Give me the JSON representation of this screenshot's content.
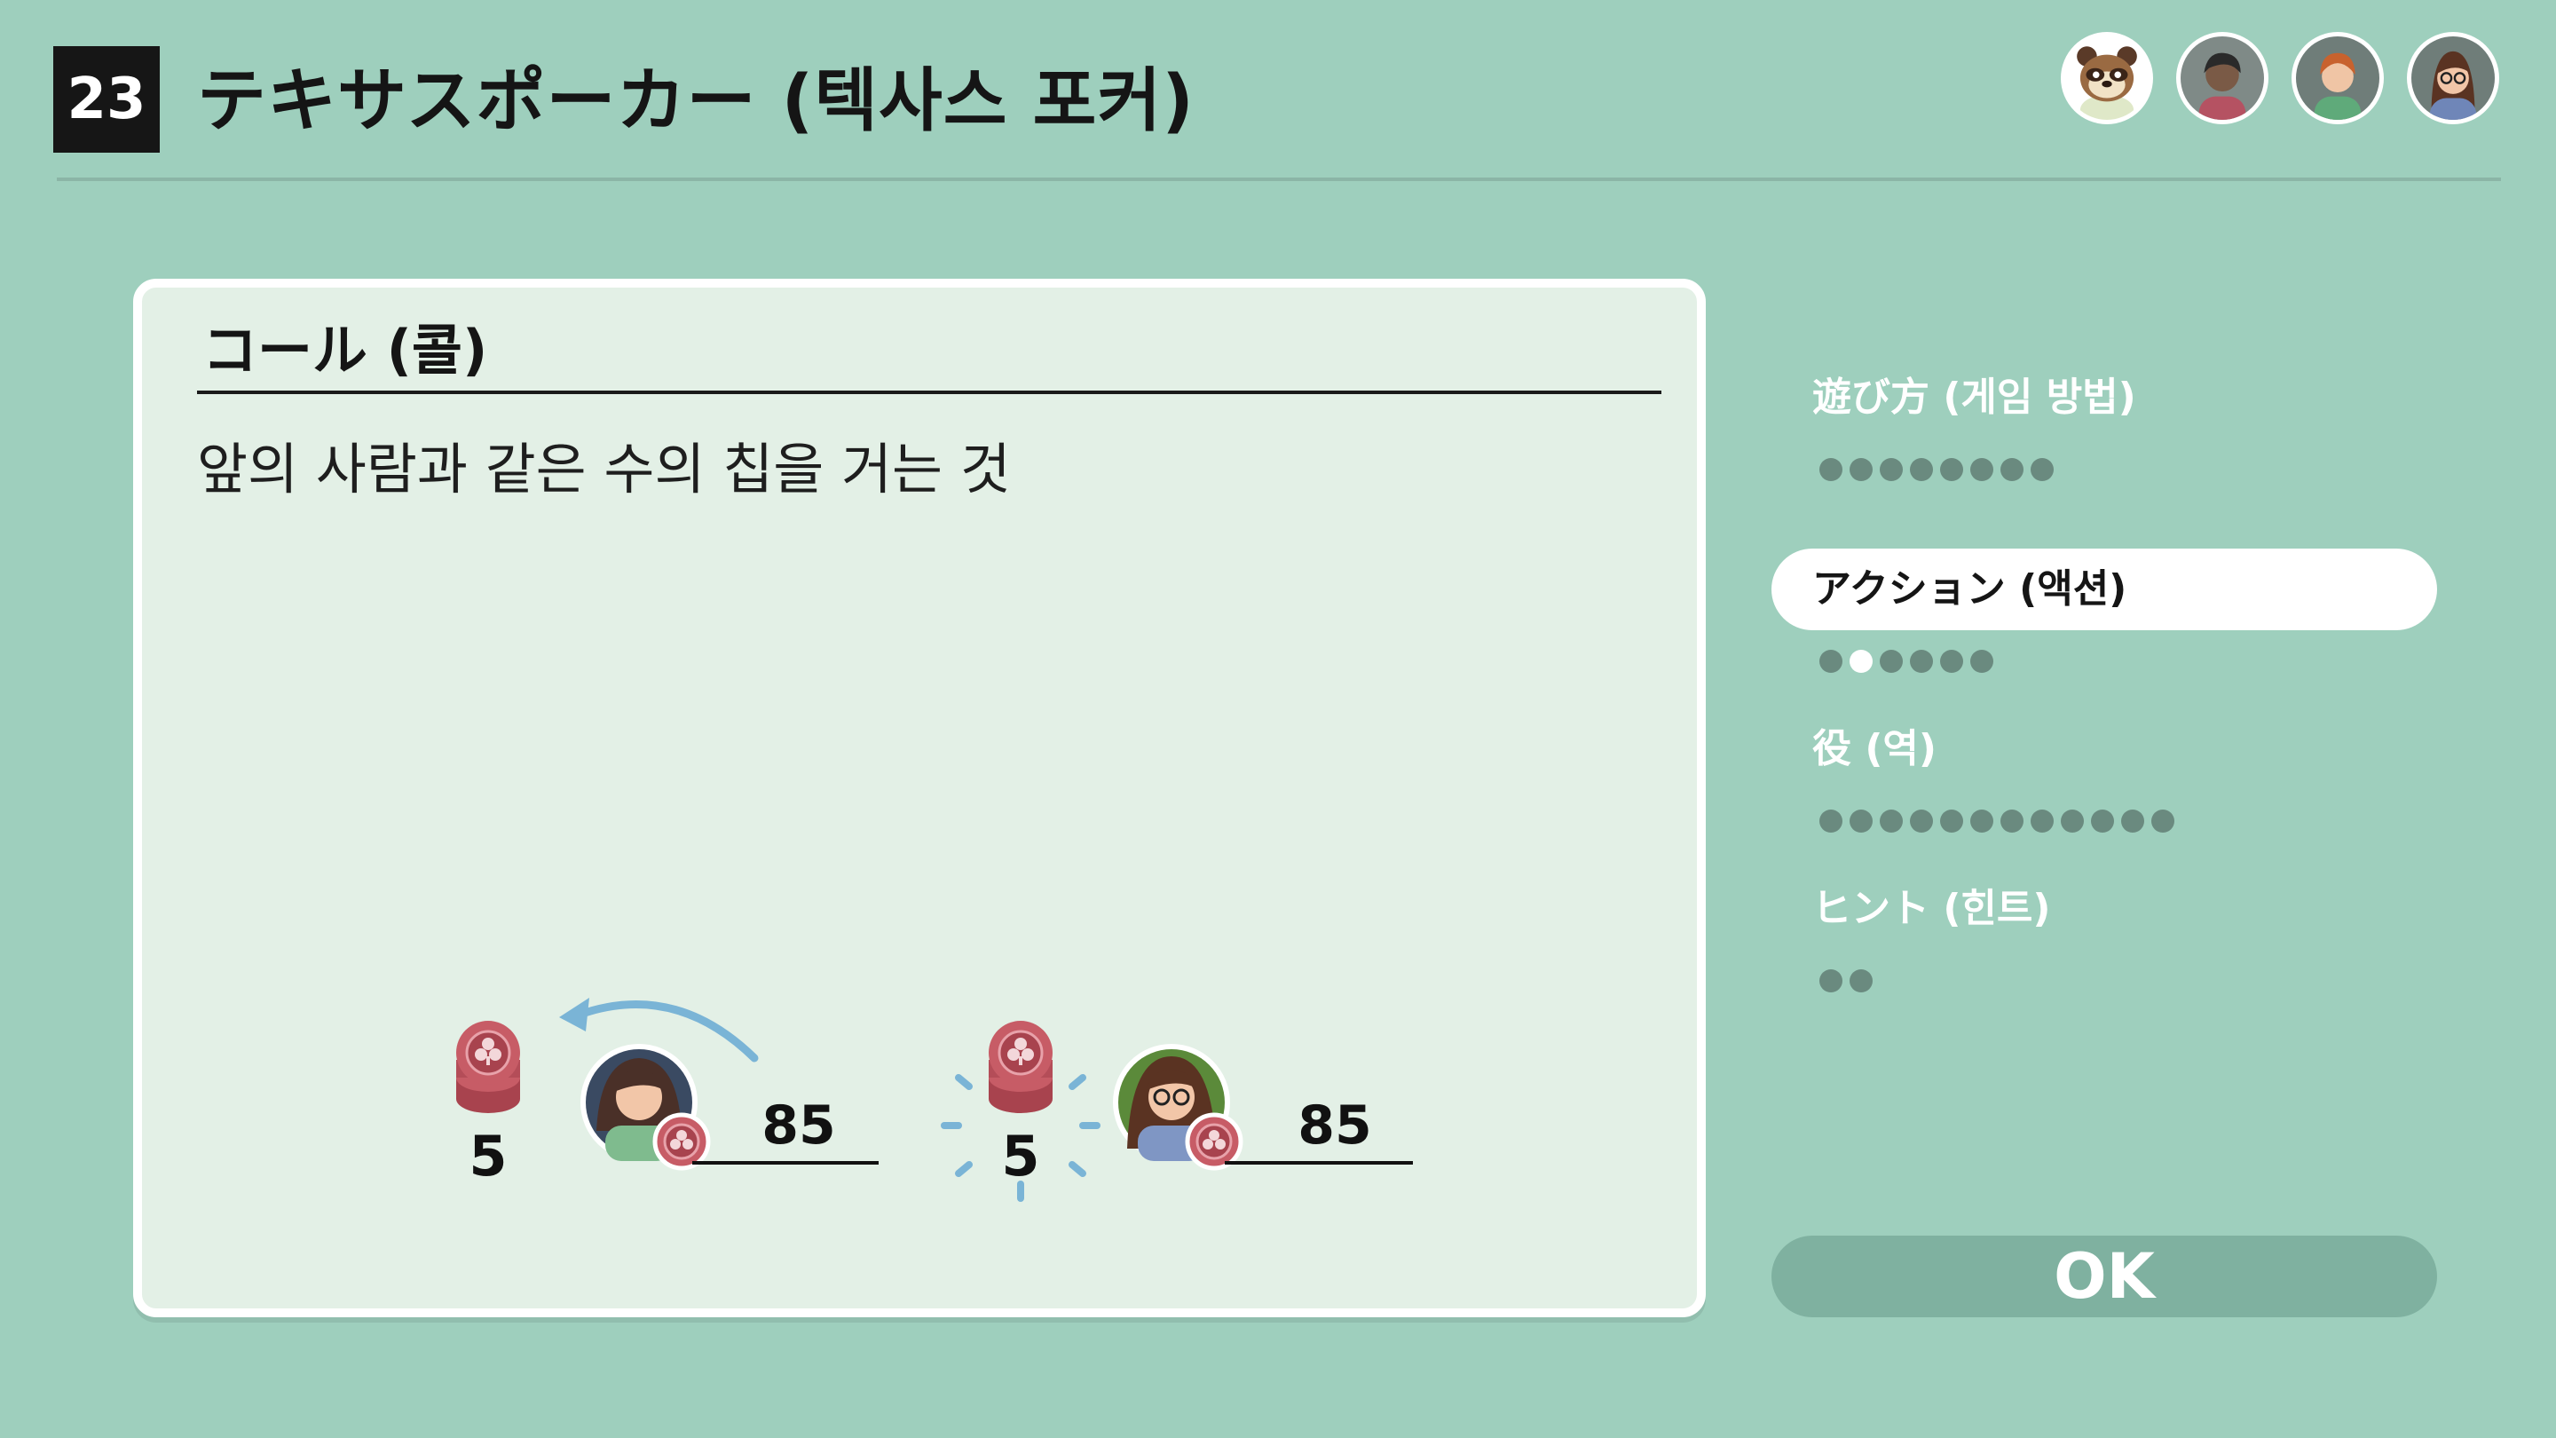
{
  "header": {
    "number": "23",
    "title": "テキサスポーカー (텍사스 포커)",
    "avatars": [
      "tanuki-avatar",
      "dark-hair-avatar",
      "orange-hair-avatar",
      "glasses-avatar"
    ]
  },
  "card": {
    "heading": "コール (콜)",
    "description": "앞의 사람과 같은 수의 칩을 거는 것",
    "illustration": {
      "player1": {
        "bet": "5",
        "chips": "85"
      },
      "player2": {
        "bet": "5",
        "chips": "85"
      }
    }
  },
  "menu": {
    "items": [
      {
        "label": "遊び方 (게임 방법)",
        "pages": 8,
        "current": null
      },
      {
        "label": "アクション (액션)",
        "pages": 6,
        "current": 2
      },
      {
        "label": "役 (역)",
        "pages": 12,
        "current": null
      },
      {
        "label": "ヒント (힌트)",
        "pages": 2,
        "current": null
      }
    ]
  },
  "ok_label": "OK",
  "colors": {
    "background": "#9ecfbd",
    "card": "#e3f0e6",
    "chip": "#c75c66",
    "arrow": "#7ab4d6"
  }
}
